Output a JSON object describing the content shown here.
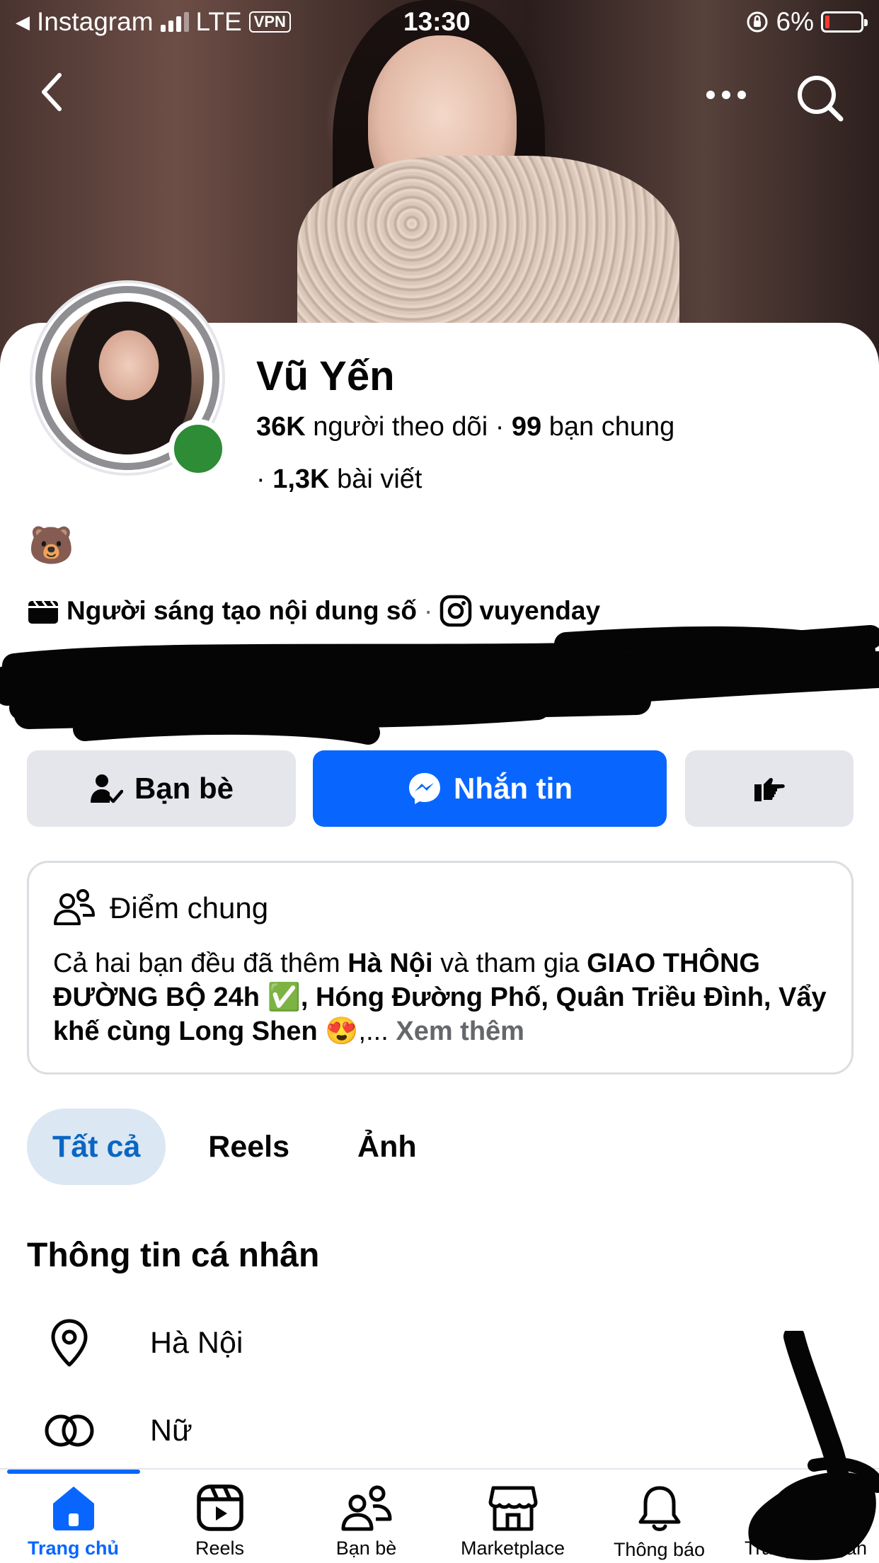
{
  "status_bar": {
    "back_app": "Instagram",
    "network": "LTE",
    "vpn": "VPN",
    "time": "13:30",
    "battery": "6%"
  },
  "profile": {
    "name": "Vũ Yến",
    "followers_count": "36K",
    "followers_label": "người theo dõi",
    "mutual_count": "99",
    "mutual_label": "bạn chung",
    "posts_count": "1,3K",
    "posts_label": "bài viết",
    "bio_emoji": "🐻",
    "category": "Người sáng tạo nội dung số",
    "instagram_handle": "vuyenday"
  },
  "actions": {
    "friends_label": "Bạn bè",
    "message_label": "Nhắn tin"
  },
  "common": {
    "title": "Điểm chung",
    "text_1": "Cả hai bạn đều đã thêm ",
    "place": "Hà Nội",
    "text_2": " và tham gia ",
    "groups": "GIAO THÔNG ĐƯỜNG BỘ 24h ✅, Hóng Đường Phố, Quân Triều Đình, Vẩy khế cùng Long Shen 😍",
    "text_3": ",... ",
    "see_more": "Xem thêm"
  },
  "tabs": [
    {
      "label": "Tất cả"
    },
    {
      "label": "Reels"
    },
    {
      "label": "Ảnh"
    }
  ],
  "personal_info": {
    "title": "Thông tin cá nhân",
    "location": "Hà Nội",
    "gender": "Nữ"
  },
  "bottom_nav": [
    {
      "label": "Trang chủ"
    },
    {
      "label": "Reels"
    },
    {
      "label": "Bạn bè"
    },
    {
      "label": "Marketplace"
    },
    {
      "label": "Thông báo"
    },
    {
      "label": "Trang cá nhân"
    }
  ],
  "colors": {
    "accent": "#0866ff",
    "online": "#2e8b36",
    "tab_active_bg": "#dbe7f2"
  }
}
